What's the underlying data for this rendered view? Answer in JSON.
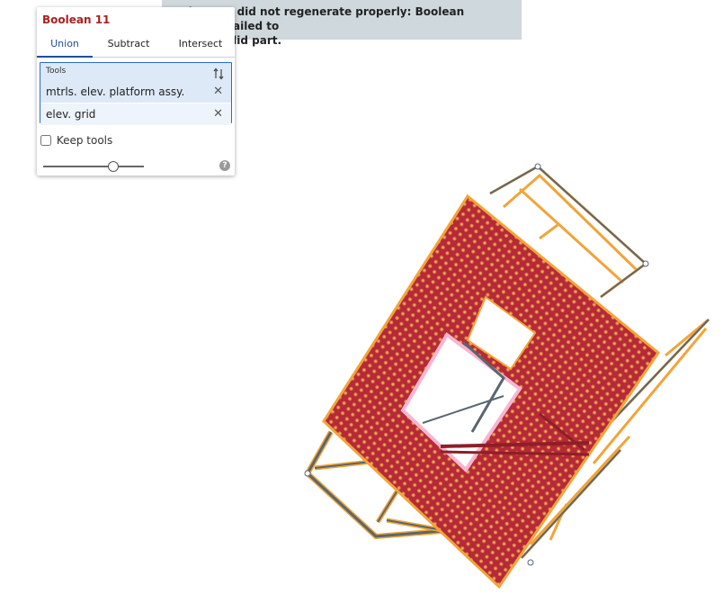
{
  "error_banner": {
    "line1": "Boolean 11 did not regenerate properly: Boolean operation failed to",
    "line2": "return a valid part."
  },
  "dialog": {
    "title": "Boolean 11",
    "tabs": [
      {
        "label": "Union",
        "active": true
      },
      {
        "label": "Subtract",
        "active": false
      },
      {
        "label": "Intersect",
        "active": false
      }
    ],
    "tools": {
      "label": "Tools",
      "items": [
        {
          "label": "mtrls. elev. platform assy."
        },
        {
          "label": "elev. grid"
        }
      ],
      "sort_icon": "sort-arrows-icon",
      "remove_icon": "close-icon"
    },
    "keep_tools": {
      "label": "Keep tools",
      "checked": false
    },
    "slider_value": 0.7,
    "help_icon": "help-icon"
  },
  "colors": {
    "title_red": "#a5231f",
    "tab_active": "#1f4f9c",
    "selection_border": "#2a6cc4",
    "selection_bg": "#dde9f6",
    "error_bg": "#cfd8dc",
    "part_red": "#b52a36",
    "edge_orange": "#f2a43a",
    "frame_gray": "#5a6670",
    "highlight_pink": "#f6b6d1"
  }
}
